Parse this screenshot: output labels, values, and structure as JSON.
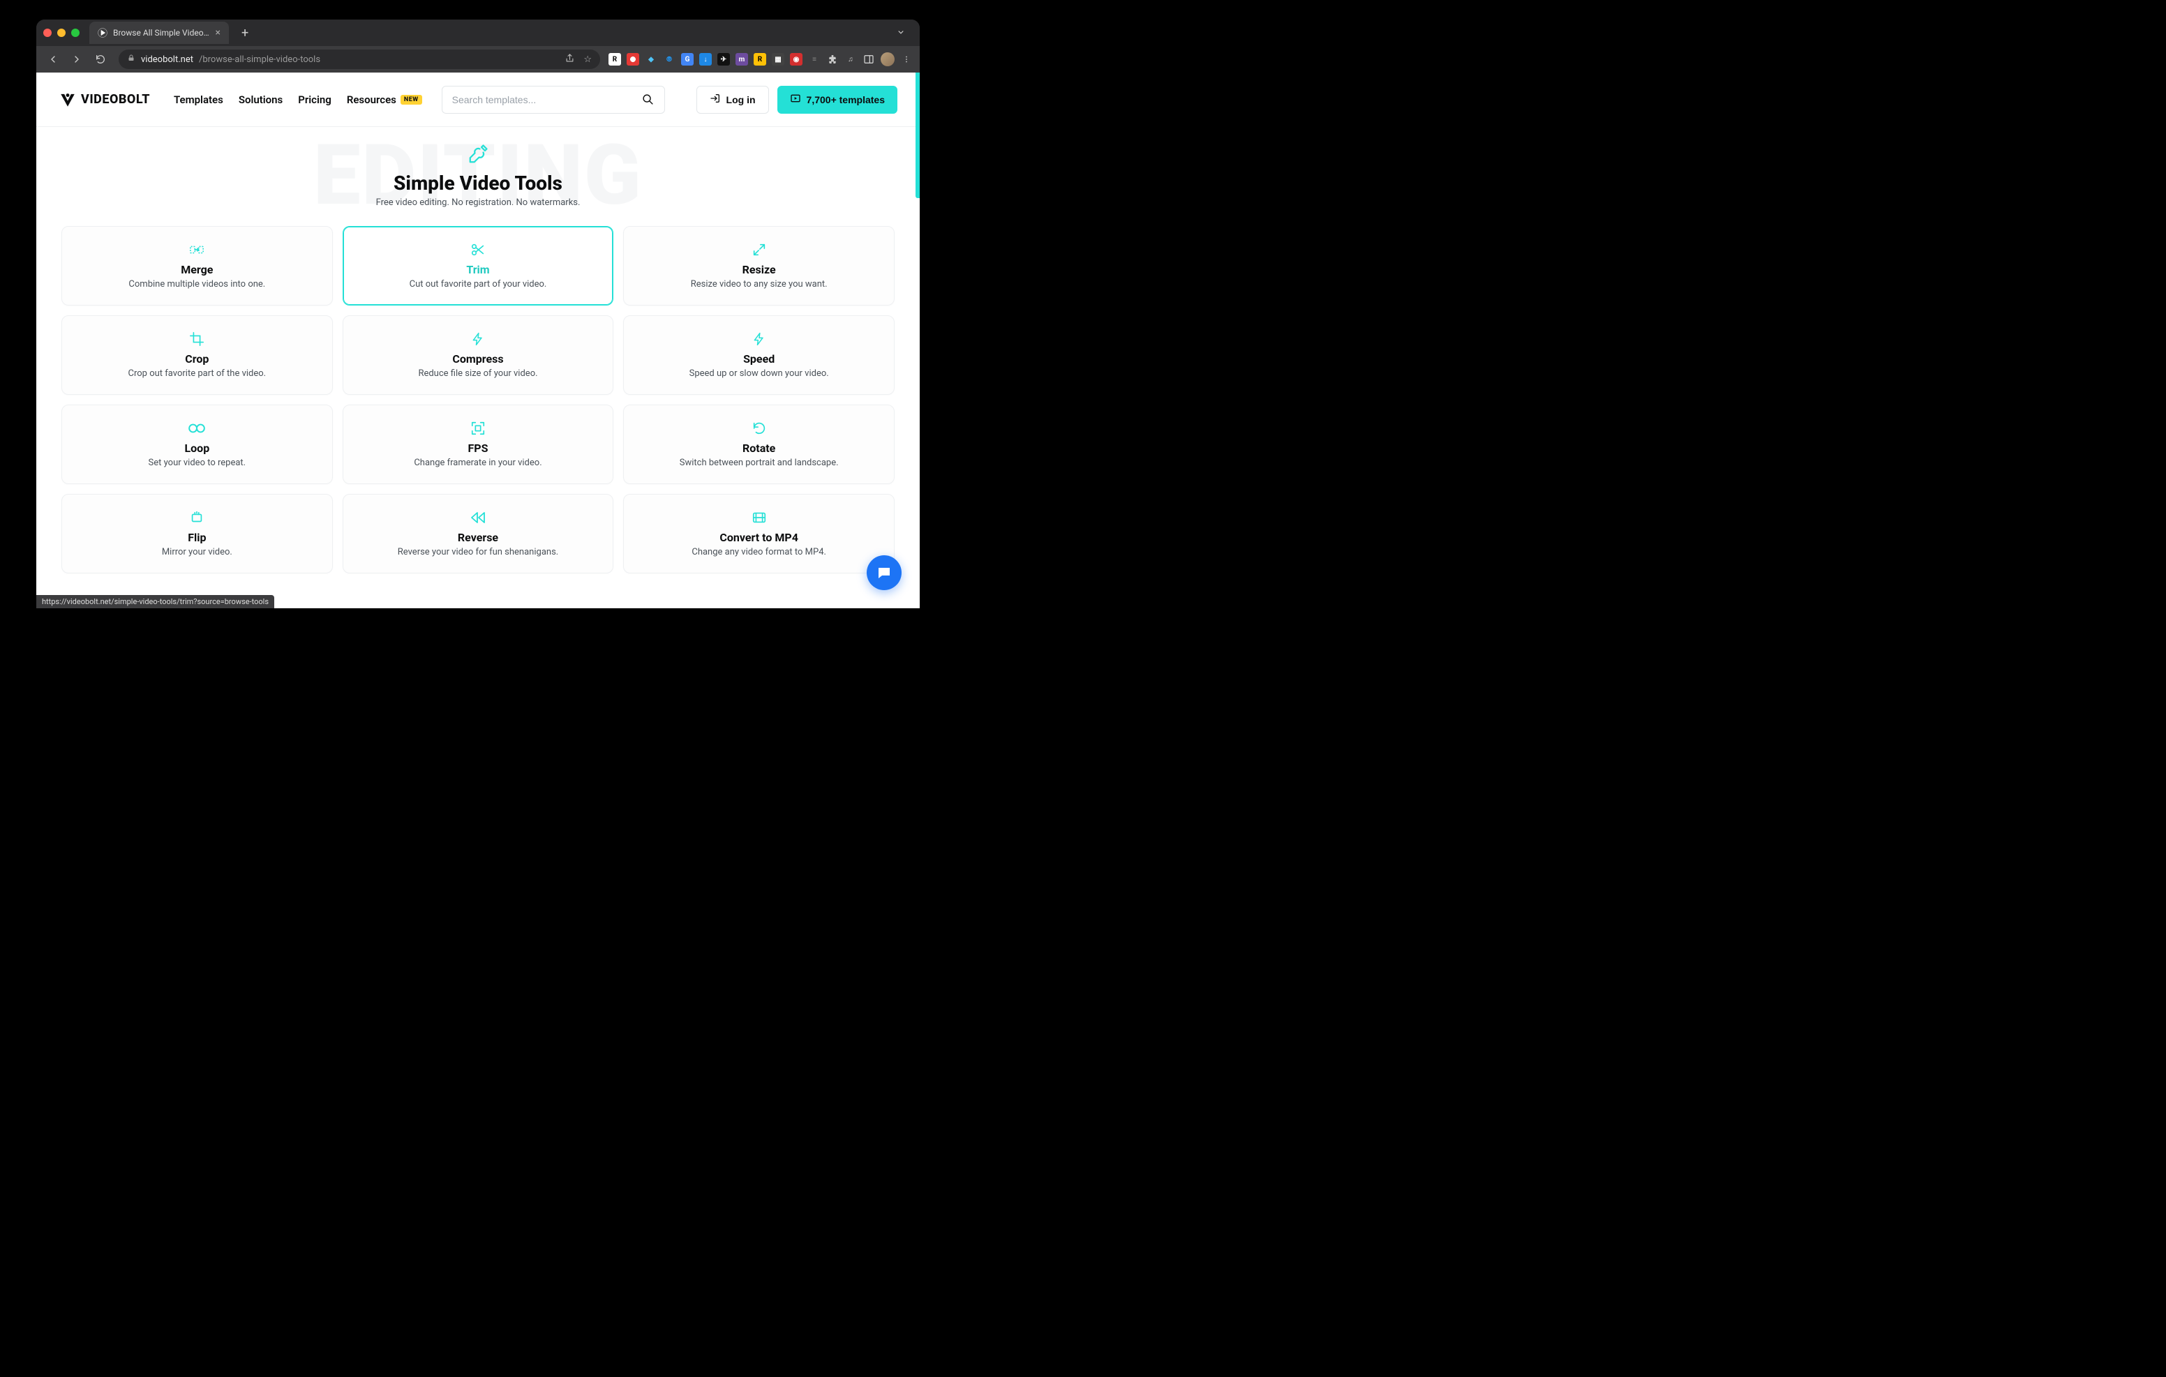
{
  "browser": {
    "tab_title": "Browse All Simple Video Tools",
    "url_domain": "videobolt.net",
    "url_path": "/browse-all-simple-video-tools",
    "status_url": "https://videobolt.net/simple-video-tools/trim?source=browse-tools"
  },
  "site": {
    "logo_text": "VIDEOBOLT",
    "nav": {
      "templates": "Templates",
      "solutions": "Solutions",
      "pricing": "Pricing",
      "resources": "Resources",
      "new_badge": "NEW"
    },
    "search_placeholder": "Search templates...",
    "login_label": "Log in",
    "cta_label": "7,700+ templates"
  },
  "hero": {
    "bg_text": "EDITING",
    "title": "Simple Video Tools",
    "subtitle": "Free video editing. No registration. No watermarks."
  },
  "tools": [
    {
      "icon": "merge",
      "title": "Merge",
      "desc": "Combine multiple videos into one."
    },
    {
      "icon": "trim",
      "title": "Trim",
      "desc": "Cut out favorite part of your video.",
      "hover": true
    },
    {
      "icon": "resize",
      "title": "Resize",
      "desc": "Resize video to any size you want."
    },
    {
      "icon": "crop",
      "title": "Crop",
      "desc": "Crop out favorite part of the video."
    },
    {
      "icon": "compress",
      "title": "Compress",
      "desc": "Reduce file size of your video."
    },
    {
      "icon": "speed",
      "title": "Speed",
      "desc": "Speed up or slow down your video."
    },
    {
      "icon": "loop",
      "title": "Loop",
      "desc": "Set your video to repeat."
    },
    {
      "icon": "fps",
      "title": "FPS",
      "desc": "Change framerate in your video."
    },
    {
      "icon": "rotate",
      "title": "Rotate",
      "desc": "Switch between portrait and landscape."
    },
    {
      "icon": "flip",
      "title": "Flip",
      "desc": "Mirror your video."
    },
    {
      "icon": "reverse",
      "title": "Reverse",
      "desc": "Reverse your video for fun shenanigans."
    },
    {
      "icon": "mp4",
      "title": "Convert to MP4",
      "desc": "Change any video format to MP4."
    }
  ]
}
